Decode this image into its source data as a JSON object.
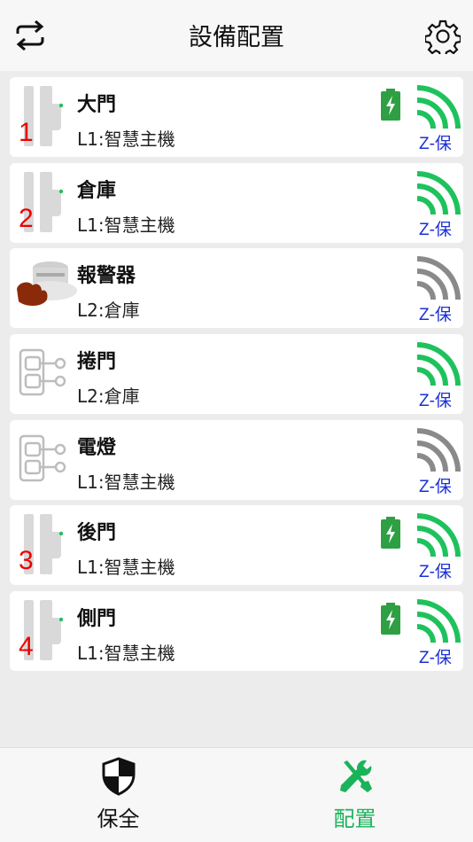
{
  "header": {
    "title": "設備配置"
  },
  "devices": [
    {
      "name": "大門",
      "location": "L1:智慧主機",
      "number": "1",
      "type": "door-sensor",
      "battery": true,
      "signal_color": "#1ec25c",
      "zlabel": "Z-保"
    },
    {
      "name": "倉庫",
      "location": "L1:智慧主機",
      "number": "2",
      "type": "door-sensor",
      "battery": false,
      "signal_color": "#1ec25c",
      "zlabel": "Z-保"
    },
    {
      "name": "報警器",
      "location": "L2:倉庫",
      "number": "",
      "type": "siren",
      "battery": false,
      "signal_color": "#8a8a8a",
      "zlabel": "Z-保"
    },
    {
      "name": "捲門",
      "location": "L2:倉庫",
      "number": "",
      "type": "switch",
      "battery": false,
      "signal_color": "#1ec25c",
      "zlabel": "Z-保"
    },
    {
      "name": "電燈",
      "location": "L1:智慧主機",
      "number": "",
      "type": "switch",
      "battery": false,
      "signal_color": "#8a8a8a",
      "zlabel": "Z-保"
    },
    {
      "name": "後門",
      "location": "L1:智慧主機",
      "number": "3",
      "type": "door-sensor",
      "battery": true,
      "signal_color": "#1ec25c",
      "zlabel": "Z-保"
    },
    {
      "name": "側門",
      "location": "L1:智慧主機",
      "number": "4",
      "type": "door-sensor",
      "battery": true,
      "signal_color": "#1ec25c",
      "zlabel": "Z-保"
    }
  ],
  "tabs": [
    {
      "label": "保全",
      "icon": "shield-icon",
      "active": false
    },
    {
      "label": "配置",
      "icon": "wrench-screwdriver-icon",
      "active": true
    }
  ],
  "colors": {
    "accent": "#1bb35a",
    "signal_active": "#1ec25c",
    "signal_weak": "#8a8a8a",
    "zlabel": "#1a2fd6",
    "number": "#e00000",
    "battery": "#2ea043"
  }
}
